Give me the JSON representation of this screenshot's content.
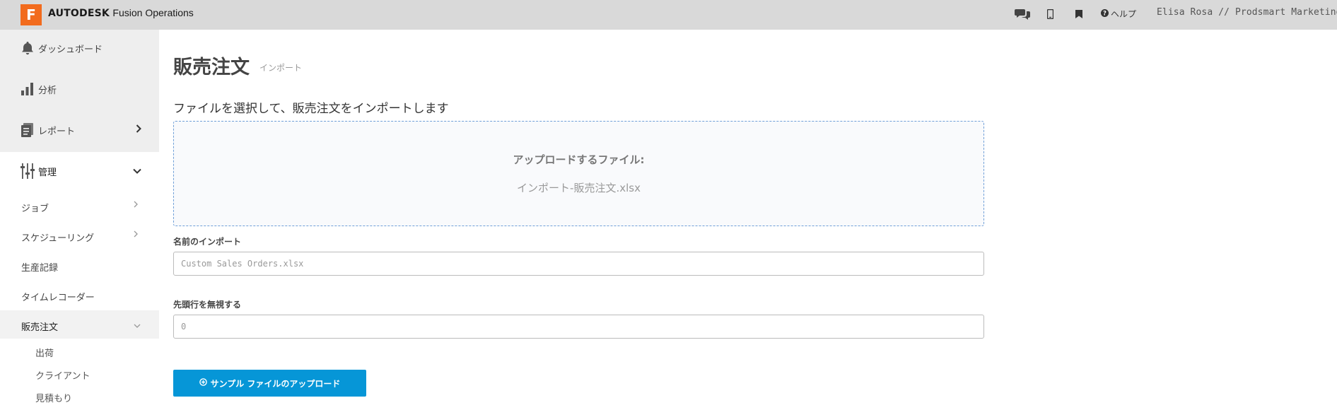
{
  "topbar": {
    "logo_letter": "F",
    "brand_bold": "AUTODESK",
    "brand_product": "Fusion Operations",
    "help_label": "ヘルプ",
    "user_label": "Elisa Rosa // Prodsmart Marketing",
    "icons": [
      "chat-icon",
      "mobile-icon",
      "bookmark-icon",
      "help-icon",
      "chevron-down-icon"
    ]
  },
  "sidebar": {
    "dashboard": "ダッシュボード",
    "analysis": "分析",
    "reports": "レポート",
    "management": "管理",
    "sub": {
      "jobs": "ジョブ",
      "scheduling": "スケジューリング",
      "production_records": "生産記録",
      "time_recorder": "タイムレコーダー",
      "sales_orders": "販売注文"
    },
    "sales_children": {
      "shipping": "出荷",
      "clients": "クライアント",
      "quotes": "見積もり"
    }
  },
  "main": {
    "title": "販売注文",
    "subtitle": "インポート",
    "heading": "ファイルを選択して、販売注文をインポートします",
    "dropzone": {
      "title": "アップロードするファイル:",
      "filename": "インポート-販売注文.xlsx"
    },
    "import_name": {
      "label": "名前のインポート",
      "placeholder": "Custom Sales Orders.xlsx"
    },
    "skip_rows": {
      "label": "先頭行を無視する",
      "placeholder": "0"
    },
    "upload_button": "サンプル ファイルのアップロード"
  },
  "colors": {
    "topbar_bg": "#d9d9d9",
    "logo_orange": "#f26b1d",
    "primary_button": "#0696d7",
    "dropzone_border": "#6f9fd8"
  }
}
